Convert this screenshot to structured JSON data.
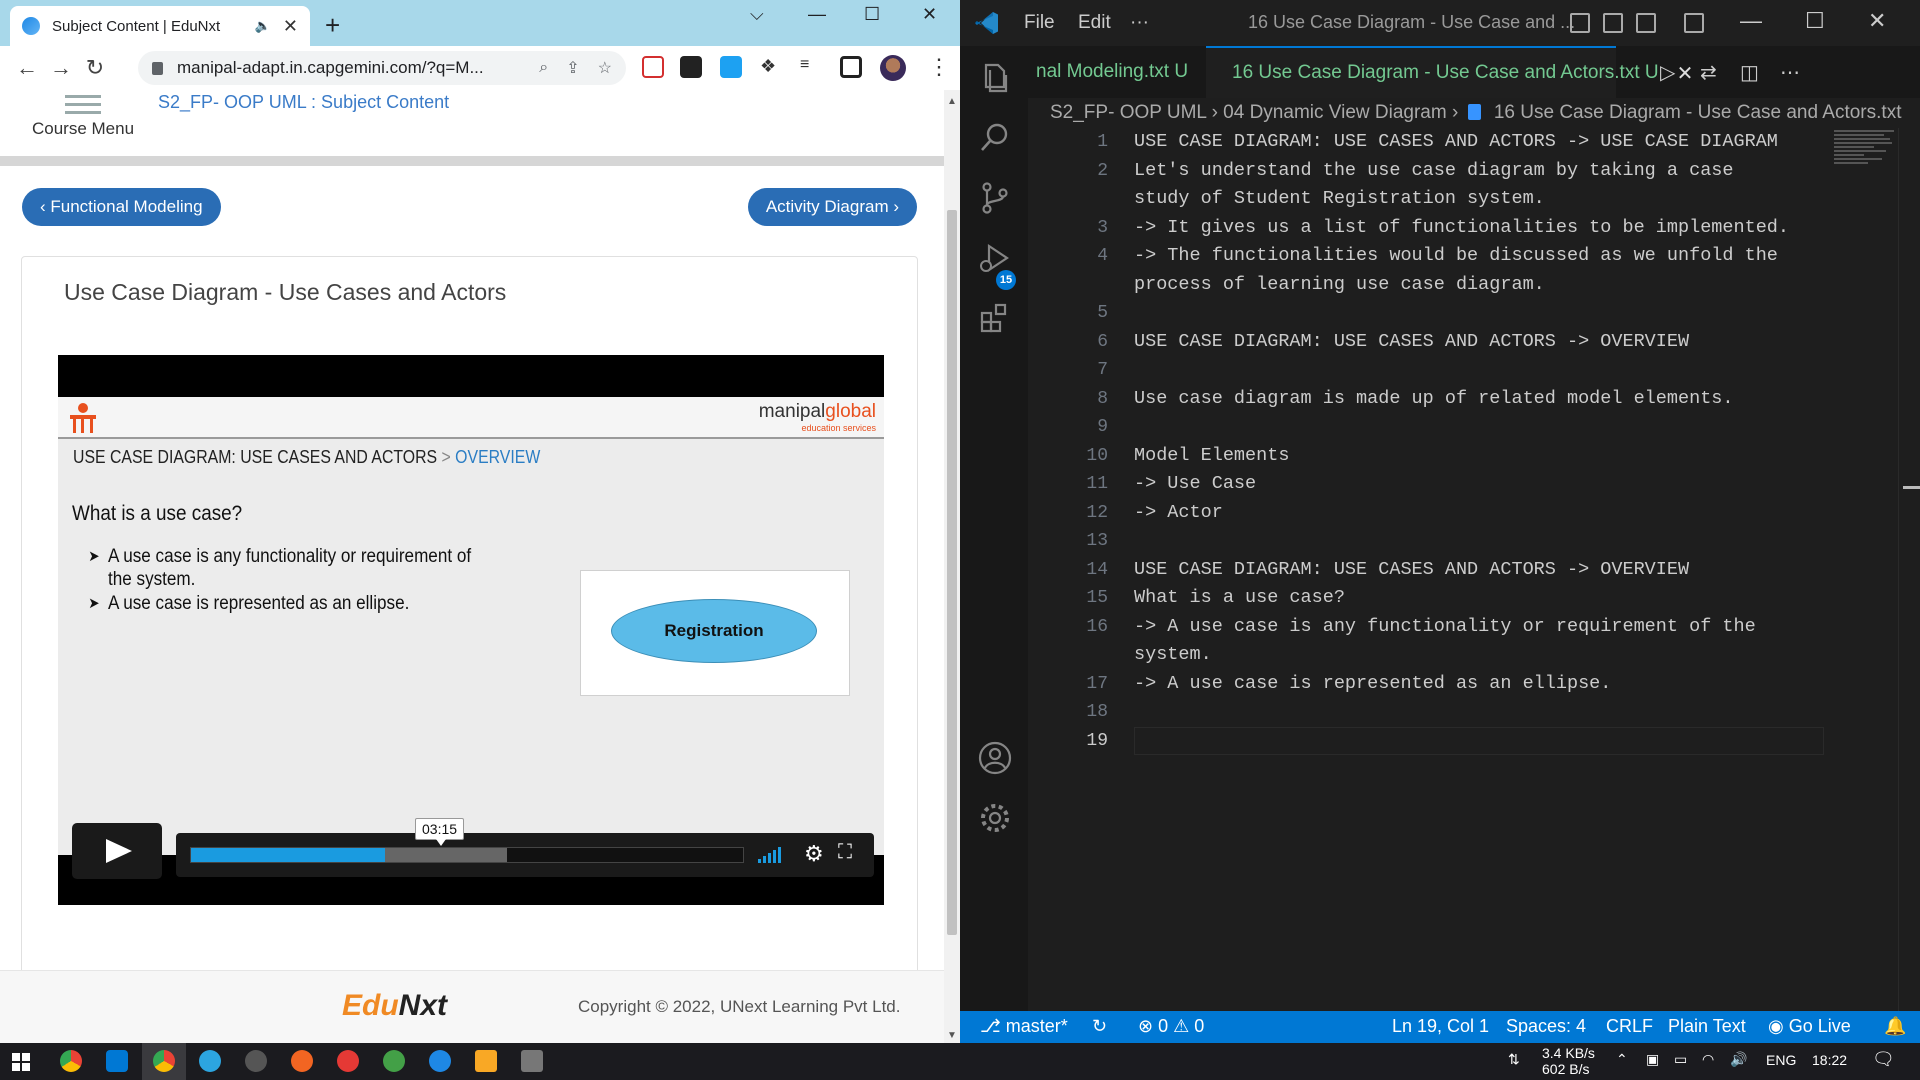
{
  "chrome": {
    "tab_title": "Subject Content | EduNxt",
    "url": "manipal-adapt.in.capgemini.com/?q=M...",
    "course_menu": "Course Menu",
    "breadcrumb": "S2_FP- OOP UML : Subject Content",
    "prev_button": "‹ Functional Modeling",
    "next_button": "Activity Diagram ›",
    "card_title": "Use Case Diagram - Use Cases and Actors",
    "footer_copyright": "Copyright © 2022, UNext Learning Pvt Ltd.",
    "footer_logo_part1": "Edu",
    "footer_logo_part2": "Nxt"
  },
  "slide": {
    "brand_main": "manipal",
    "brand_accent": "global",
    "brand_sub": "education services",
    "heading": "USE CASE DIAGRAM: USE CASES AND ACTORS",
    "heading_sep": " > ",
    "heading_section": "OVERVIEW",
    "question": "What is a use case?",
    "bullet1": "A use case is any functionality or requirement of the system.",
    "bullet2": "A use case is represented as an ellipse.",
    "ellipse_label": "Registration"
  },
  "video": {
    "time": "03:15",
    "played_fraction": 0.35,
    "buffered_fraction": 0.57
  },
  "vscode": {
    "menu_file": "File",
    "menu_edit": "Edit",
    "menu_more": "···",
    "window_title": "16 Use Case Diagram - Use Case and ...",
    "tab1": "nal Modeling.txt  U",
    "tab2": "16 Use Case Diagram - Use Case and Actors.txt  U",
    "breadcrumb_1": "S2_FP- OOP UML",
    "breadcrumb_2": "04 Dynamic View Diagram",
    "breadcrumb_3": "16 Use Case Diagram - Use Case and Actors.txt",
    "scm_badge": "15",
    "lines": [
      {
        "n": "1",
        "t": "USE CASE DIAGRAM: USE CASES AND ACTORS -> USE CASE DIAGRAM"
      },
      {
        "n": "2",
        "t": "Let's understand the use case diagram by taking a case\nstudy of Student Registration system."
      },
      {
        "n": "3",
        "t": "-> It gives us a list of functionalities to be implemented."
      },
      {
        "n": "4",
        "t": "-> The functionalities would be discussed as we unfold the\nprocess of learning use case diagram."
      },
      {
        "n": "5",
        "t": ""
      },
      {
        "n": "6",
        "t": "USE CASE DIAGRAM: USE CASES AND ACTORS -> OVERVIEW"
      },
      {
        "n": "7",
        "t": ""
      },
      {
        "n": "8",
        "t": "Use case diagram is made up of related model elements."
      },
      {
        "n": "9",
        "t": ""
      },
      {
        "n": "10",
        "t": "Model Elements"
      },
      {
        "n": "11",
        "t": "-> Use Case"
      },
      {
        "n": "12",
        "t": "-> Actor"
      },
      {
        "n": "13",
        "t": ""
      },
      {
        "n": "14",
        "t": "USE CASE DIAGRAM: USE CASES AND ACTORS -> OVERVIEW"
      },
      {
        "n": "15",
        "t": "What is a use case?"
      },
      {
        "n": "16",
        "t": "-> A use case is any functionality or requirement of the\nsystem."
      },
      {
        "n": "17",
        "t": "-> A use case is represented as an ellipse."
      },
      {
        "n": "18",
        "t": ""
      },
      {
        "n": "19",
        "t": ""
      }
    ],
    "status": {
      "branch": "master*",
      "errors": "0",
      "warnings": "0",
      "position": "Ln 19, Col 1",
      "spaces": "Spaces: 4",
      "eol": "CRLF",
      "language": "Plain Text",
      "golive": "Go Live"
    }
  },
  "taskbar": {
    "net_up": "3.4 KB/s",
    "net_down": "602 B/s",
    "lang": "ENG",
    "time": "18:22"
  },
  "colors": {
    "accent_blue": "#0078d4",
    "chrome_tabstrip": "#a8d8ea",
    "button_blue": "#2a6db5",
    "untracked_green": "#73c991"
  }
}
